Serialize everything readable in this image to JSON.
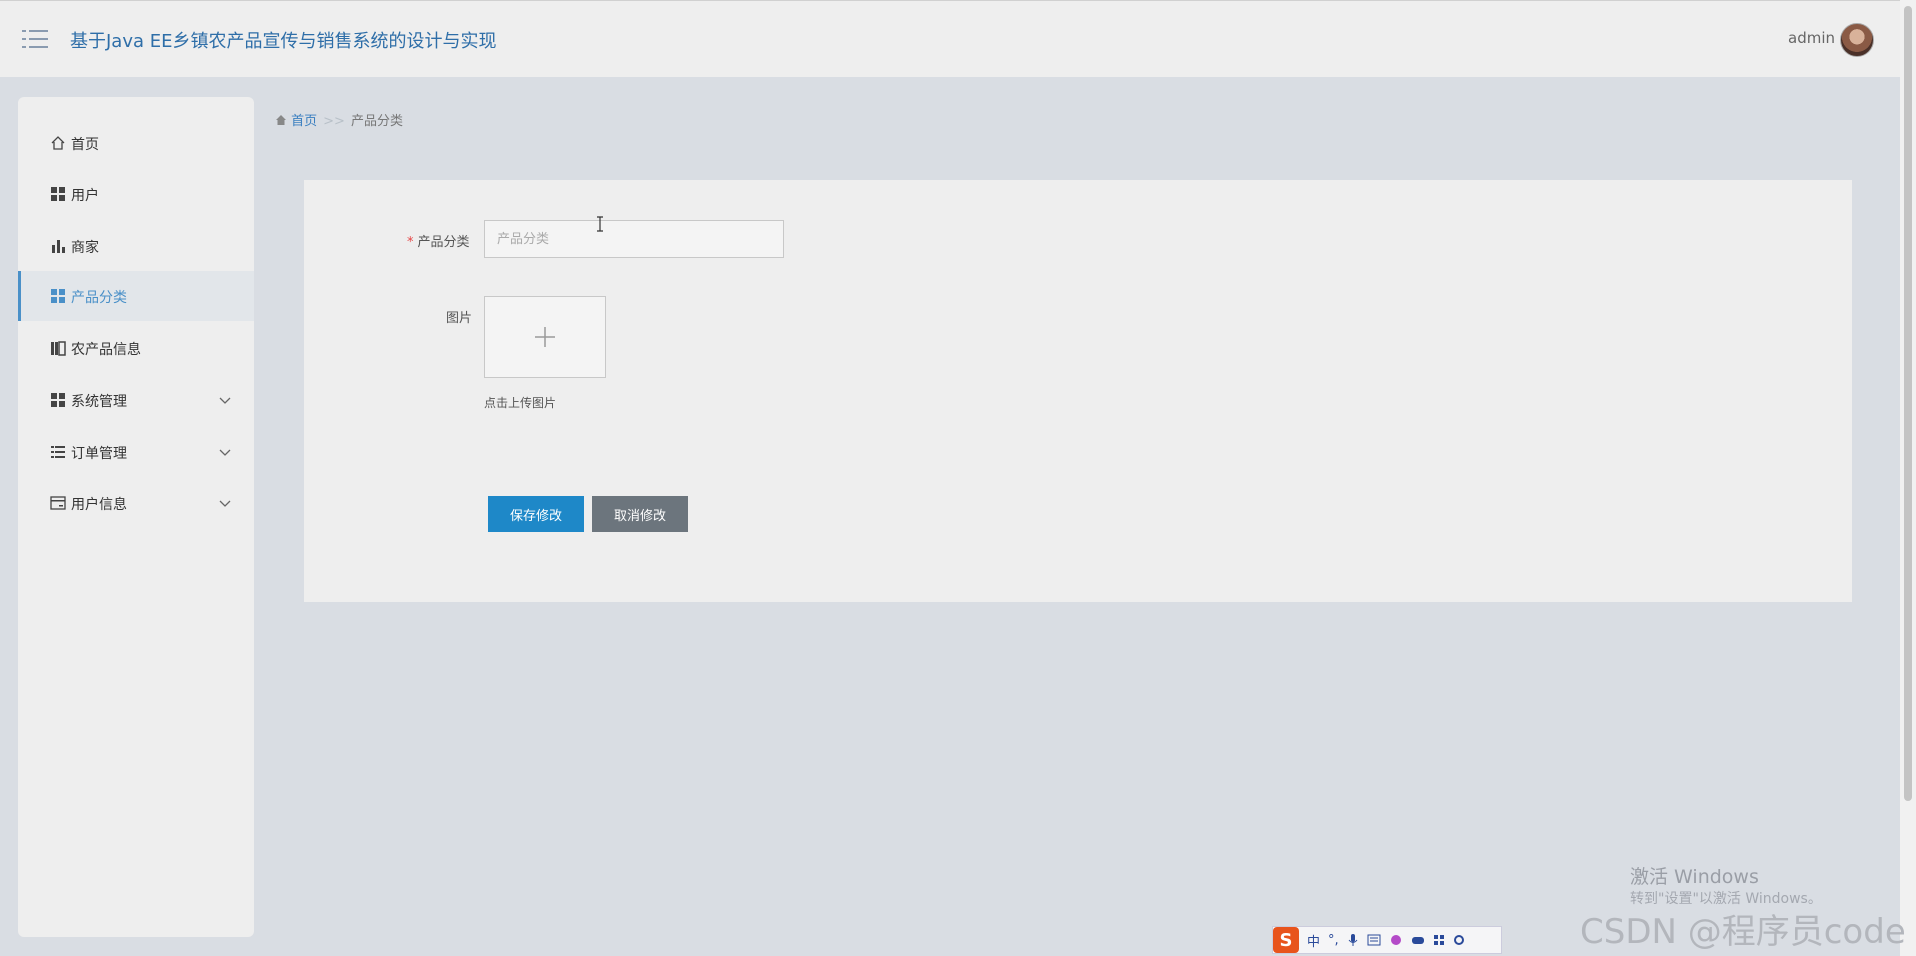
{
  "header": {
    "title": "基于Java EE乡镇农产品宣传与销售系统的设计与实现",
    "user": "admin"
  },
  "sidebar": {
    "items": [
      {
        "label": "首页",
        "icon": "home-icon"
      },
      {
        "label": "用户",
        "icon": "grid-icon"
      },
      {
        "label": "商家",
        "icon": "bar-chart-icon"
      },
      {
        "label": "产品分类",
        "icon": "grid-icon",
        "active": true
      },
      {
        "label": "农产品信息",
        "icon": "book-icon"
      },
      {
        "label": "系统管理",
        "icon": "grid-icon",
        "expandable": true
      },
      {
        "label": "订单管理",
        "icon": "list-icon",
        "expandable": true
      },
      {
        "label": "用户信息",
        "icon": "card-icon",
        "expandable": true
      }
    ]
  },
  "breadcrumb": {
    "home": "首页",
    "separator": ">>",
    "current": "产品分类"
  },
  "form": {
    "category_label": "产品分类",
    "required_mark": "*",
    "category_placeholder": "产品分类",
    "category_value": "",
    "image_label": "图片",
    "upload_hint": "点击上传图片",
    "save_label": "保存修改",
    "cancel_label": "取消修改"
  },
  "overlay": {
    "activate_title": "激活 Windows",
    "activate_sub": "转到\"设置\"以激活 Windows。",
    "csdn": "CSDN @程序员code",
    "ime_mode": "中",
    "ime_punct": "°,"
  },
  "colors": {
    "accent": "#1e88c8",
    "title": "#2e6ea8",
    "cancel": "#6c757d",
    "required": "#e54545"
  }
}
